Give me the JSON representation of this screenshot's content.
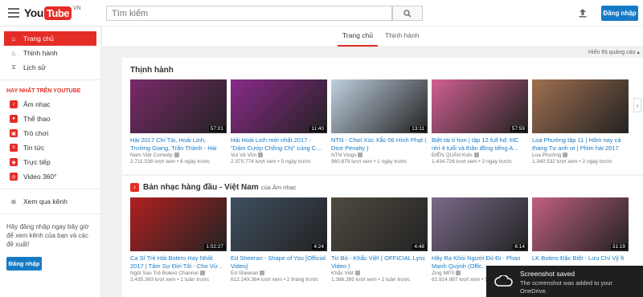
{
  "header": {
    "logo_you": "You",
    "logo_tube": "Tube",
    "logo_region": "VN",
    "search_placeholder": "Tìm kiếm",
    "signin_label": "Đăng nhập"
  },
  "sidebar": {
    "items": [
      {
        "label": "Trang chủ",
        "icon": "home-icon",
        "active": true
      },
      {
        "label": "Thịnh hành",
        "icon": "flame-icon"
      },
      {
        "label": "Lịch sử",
        "icon": "history-icon"
      }
    ],
    "section_title": "HAY NHẤT TRÊN YOUTUBE",
    "channels": [
      {
        "label": "Âm nhạc",
        "icon": "music-icon"
      },
      {
        "label": "Thể thao",
        "icon": "sports-icon"
      },
      {
        "label": "Trò chơi",
        "icon": "gaming-icon"
      },
      {
        "label": "Tin tức",
        "icon": "news-icon"
      },
      {
        "label": "Trực tiếp",
        "icon": "live-icon"
      },
      {
        "label": "Video 360°",
        "icon": "360-icon"
      }
    ],
    "browse_channels": "Xem qua kênh",
    "promo_text": "Hãy đăng nhập ngay bây giờ để xem kênh của bạn và các đề xuất!",
    "signin_label": "Đăng nhập"
  },
  "tabs": [
    {
      "label": "Trang chủ",
      "active": true
    },
    {
      "label": "Thịnh hành",
      "active": false
    }
  ],
  "ad_note": "Hiển thị quảng cáo ▴",
  "shelves": [
    {
      "title": "Thịnh hành",
      "videos": [
        {
          "title": "Hài 2017 Chí Tài, Hoài Linh, Trường Giang, Trấn Thành - Hài",
          "channel": "Nam Việt Comedy",
          "views": "2.711.538 lượt xem",
          "age": "6 ngày trước",
          "duration": "57:01",
          "color": "#7a2a6a"
        },
        {
          "title": "Hài Hoài Linh mới nhất 2017 - \"Dám Cướp Chồng Chị\" cùng C...",
          "channel": "Vui Vẻ Vồn",
          "views": "2.370.774 lượt xem",
          "age": "5 ngày trước",
          "duration": "11:40",
          "color": "#8a2a8a"
        },
        {
          "title": "NTN - Chơi Xúc Xắc 06 Hình Phạt ( Dice Penalty )",
          "channel": "NTN Vlogs",
          "views": "960.879 lượt xem",
          "age": "1 ngày trước",
          "duration": "13:11",
          "color": "#c0d0e0"
        },
        {
          "title": "Biệt tài tí hon | tập 12 full hd: MC nhí 4 tuổi và thần đồng tiếng A...",
          "channel": "ĐIỀN QUÂN Kids",
          "views": "1.434.726 lượt xem",
          "age": "2 ngày trước",
          "duration": "57:59",
          "color": "#d06090"
        },
        {
          "title": "Loa Phường tập 11 | Hôm nay cả thàng Tư anh ơi | Phim hài 2017",
          "channel": "Loa Phường",
          "views": "1.340.532 lượt xem",
          "age": "2 ngày trước",
          "duration": "",
          "color": "#a07050"
        }
      ]
    },
    {
      "title": "Bản nhạc hàng đầu - Việt Nam",
      "subtitle": "của Âm nhạc",
      "videos": [
        {
          "title": "Ca Sĩ Trẻ Hát Bolero Hay Nhất 2017 | Tâm Sự Đời Tôi - Cho Vừ...",
          "channel": "Ngôi Sao Trẻ Bolero Channel",
          "views": "3.435.393 lượt xem",
          "age": "1 tuần trước",
          "duration": "1:02:27",
          "color": "#b02020"
        },
        {
          "title": "Ed Sheeran - Shape of You [Official Video]",
          "channel": "Ed Sheeran",
          "views": "612.249.384 lượt xem",
          "age": "2 tháng trước",
          "duration": "4:24",
          "color": "#405060"
        },
        {
          "title": "Từ Bỏ - Khắc Việt ( OFFICIAL Lyric Video )",
          "channel": "Khắc Việt",
          "views": "1.386.265 lượt xem",
          "age": "2 tuần trước",
          "duration": "4:48",
          "color": "#504a40"
        },
        {
          "title": "Hãy Ra Khỏi Người Đó Đi - Phan Mạnh Quỳnh (Offic...",
          "channel": "Zing MP3",
          "views": "62.914.987 lượt xem",
          "age": "5 tháng trước",
          "duration": "6:14",
          "color": "#7a6a8a"
        },
        {
          "title": "LK Bolero Đặc Biệt - Lưu Chí Vỹ ft",
          "channel": "",
          "views": "",
          "age": "",
          "duration": "31:19",
          "color": "#c06080"
        }
      ]
    }
  ],
  "toast": {
    "title": "Screenshot saved",
    "body": "The screenshot was added to your OneDrive."
  }
}
